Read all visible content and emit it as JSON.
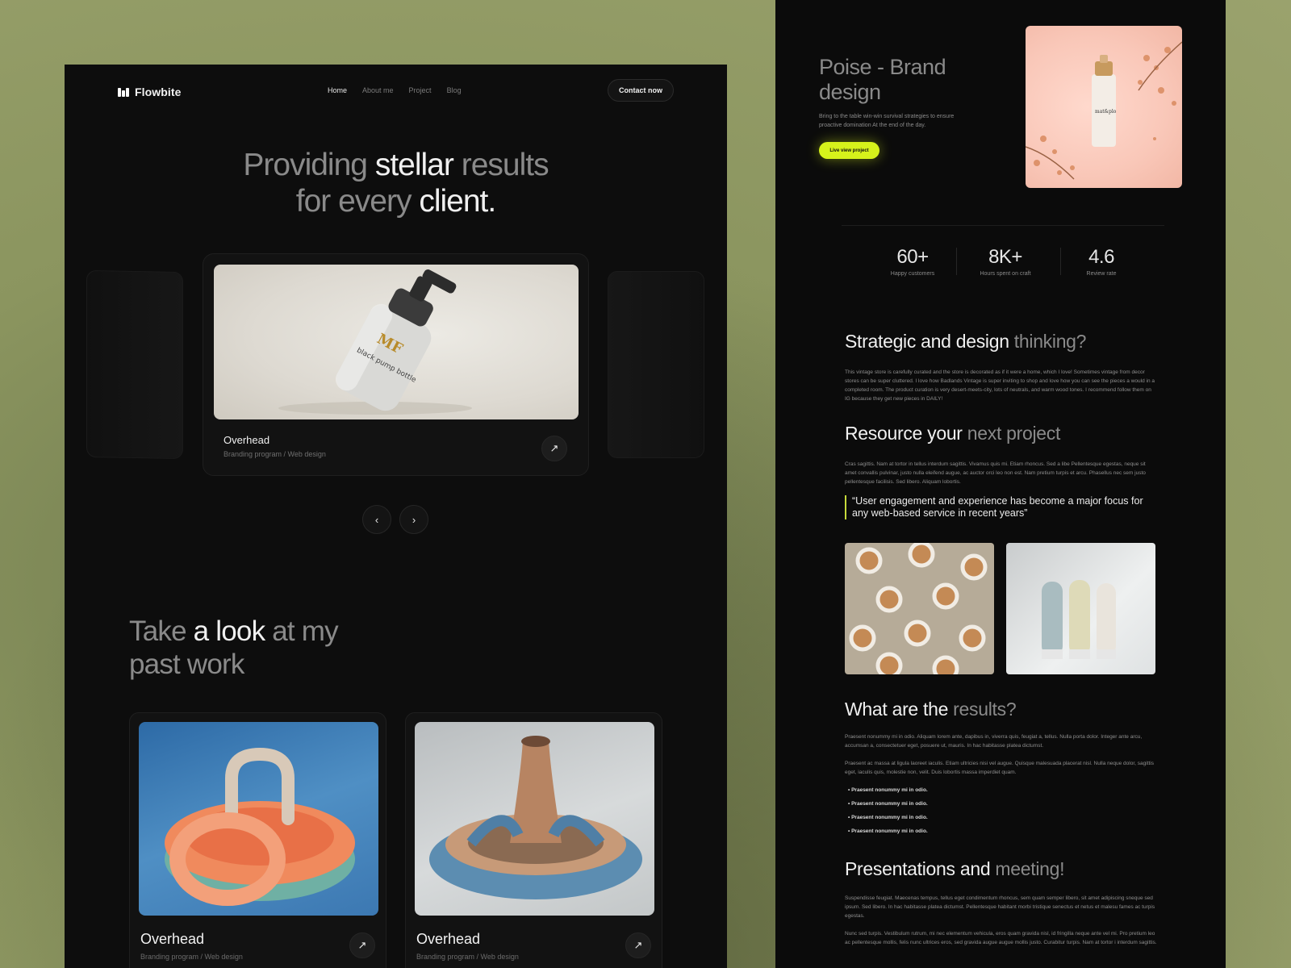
{
  "left_page": {
    "nav": {
      "logo": "Flowbite",
      "links": [
        "Home",
        "About me",
        "Project",
        "Blog"
      ],
      "contact": "Contact now"
    },
    "hero": {
      "line1_a": "Providing",
      "line1_b": "stellar",
      "line1_c": "results",
      "line2_a": "for every",
      "line2_b": "client."
    },
    "featured": {
      "title": "Overhead",
      "subtitle": "Branding program / Web design",
      "bottle_label": "black pump bottle"
    },
    "past": {
      "w1": "Take",
      "w2": "a",
      "w3": "look",
      "w4": "at",
      "w5": "my",
      "w6": "past work"
    },
    "works": [
      {
        "title": "Overhead",
        "subtitle": "Branding program / Web design"
      },
      {
        "title": "Overhead",
        "subtitle": "Branding program / Web design"
      }
    ]
  },
  "right_page": {
    "project": {
      "title_a": "Poise - Brand",
      "title_b": "design",
      "description": "Bring to the table win-win survival strategies to ensure proactive domination At the end of the day.",
      "cta": "Live view project"
    },
    "stats": [
      {
        "value": "60+",
        "label": "Happy customers"
      },
      {
        "value": "8K+",
        "label": "Hours spent on craft"
      },
      {
        "value": "4.6",
        "label": "Review rate"
      }
    ],
    "sections": {
      "strategic": {
        "title_a": "Strategic and design",
        "title_b": "thinking?",
        "text": "This vintage store is carefully curated and the store is decorated as if it were a home, which I love! Sometimes vintage from decor stores can be super cluttered. I love how Badlands Vintage is super inviting to shop and love how you can see the pieces a would in a completed room. The product curation is very desert-meets-city, lots of neutrals, and warm wood tones. I recommend follow them on IG because they get new pieces in DAILY!"
      },
      "resource": {
        "title_a": "Resource your",
        "title_b": "next project",
        "text": "Cras sagittis. Nam at tortor in tellus interdum sagittis. Vivamus quis mi. Etiam rhoncus. Sed a libe Pellentesque egestas, neque sit amet convallis pulvinar, justo nulla eleifend augue, ac auctor orci leo non est. Nam pretium turpis et arcu. Phasellus nec sem justo pellentesque facilisis. Sed libero. Aliquam lobortis.",
        "quote": "“User engagement and experience has become a major focus for any web-based service in recent years”"
      },
      "results": {
        "title_a": "What are the",
        "title_b": "results?",
        "text1": "Praesent nonummy mi in odio. Aliquam lorem ante, dapibus in, viverra quis, feugiat a, tellus. Nulla porta dolor. Integer ante arcu, accumsan a, consectetuer eget, posuere ut, mauris. In hac habitasse platea dictumst.",
        "text2": "Praesent ac massa at ligula laoreet iaculis. Etiam ultricies nisi vel augue. Quisque malesuada placerat nisl. Nulla neque dolor, sagittis eget, iaculis quis, molestie non, velit. Duis lobortis massa imperdiet quam.",
        "bullets": [
          "Praesent nonummy mi in odio.",
          "Praesent nonummy mi in odio.",
          "Praesent nonummy mi in odio.",
          "Praesent nonummy mi in odio."
        ]
      },
      "presentations": {
        "title_a": "Presentations and",
        "title_b": "meeting!",
        "text1": "Suspendisse feugiat. Maecenas tempus, tellus eget condimentum rhoncus, sem quam semper libero, sit amet adipiscing sneque sed ipsum. Sed libero. In hac habitasse platea dictumst. Pellentesque habitant morbi tristique senectus et netus et malesu fames ac turpis egestas.",
        "text2": "Nunc sed turpis. Vestibulum rutrum, mi nec elementum vehicula, eros quam gravida nisl, id fringilla neque ante vel mi. Pro pretium leo ac pellentesque mollis, felis nunc ultrices eros, sed gravida augue augue mollis justo. Curabitur turpis. Nam at tortor i interdum sagittis."
      }
    }
  },
  "colors": {
    "page_bg": "#8b955f",
    "panel_bg": "#0d0d0d",
    "accent": "#d6f21b"
  }
}
